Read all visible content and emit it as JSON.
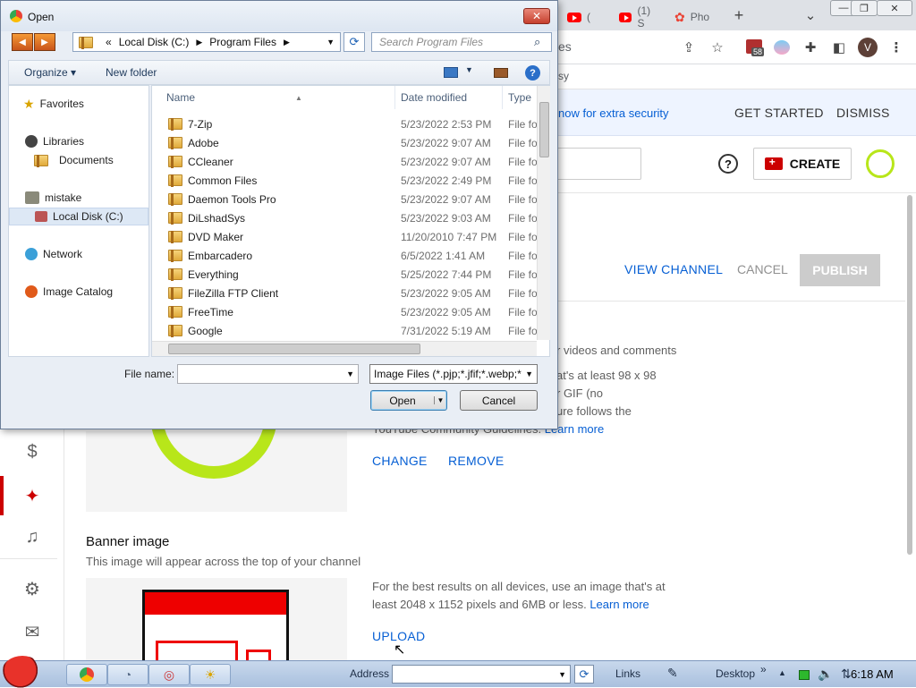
{
  "browser": {
    "tabs": [
      {
        "icon": "youtube-icon",
        "label": "("
      },
      {
        "icon": "youtube-icon",
        "label": "(1) S"
      },
      {
        "icon": "photos-icon",
        "label": "Pho"
      }
    ],
    "new_tab": "+",
    "window_controls": {
      "dropdown": "⌄",
      "minimize": "—",
      "restore": "❐",
      "close": "✕"
    },
    "omnibox_suffix": "es",
    "extension_badge": "58",
    "avatar_letter": "V",
    "bookmark_text": "sy"
  },
  "studio": {
    "banner": {
      "text": "now for extra security",
      "get_started": "GET STARTED",
      "dismiss": "DISMISS"
    },
    "header": {
      "create_label": "CREATE"
    },
    "actions": {
      "view_channel": "VIEW CHANNEL",
      "cancel": "CANCEL",
      "publish": "PUBLISH"
    },
    "picture": {
      "line1": "r videos and comments",
      "desc1": "at's at least 98 x 98",
      "desc2": "r GIF (no",
      "desc3": "ure follows the",
      "desc4": "YouTube Community Guidelines.",
      "learn_more": "Learn more",
      "change": "CHANGE",
      "remove": "REMOVE"
    },
    "banner_image": {
      "title": "Banner image",
      "subtitle": "This image will appear across the top of your channel",
      "desc_line1": "For the best results on all devices, use an image that's at",
      "desc_line2": "least 2048 x 1152 pixels and 6MB or less.",
      "learn_more": "Learn more",
      "upload": "UPLOAD"
    },
    "sidebar_icons": [
      "dollar-icon",
      "magic-wand-icon",
      "audio-library-icon",
      "settings-icon",
      "feedback-icon"
    ]
  },
  "dialog": {
    "title": "Open",
    "breadcrumb": {
      "prefix": "«",
      "parts": [
        "Local Disk (C:)",
        "Program Files"
      ]
    },
    "search_placeholder": "Search Program Files",
    "organize": "Organize ▾",
    "new_folder": "New folder",
    "nav": {
      "favorites": "Favorites",
      "libraries": "Libraries",
      "documents": "Documents",
      "mistake": "mistake",
      "local_disk": "Local Disk (C:)",
      "network": "Network",
      "image_catalog": "Image Catalog"
    },
    "columns": {
      "name": "Name",
      "date": "Date modified",
      "type": "Type"
    },
    "files": [
      {
        "name": "7-Zip",
        "date": "5/23/2022 2:53 PM",
        "type": "File fol"
      },
      {
        "name": "Adobe",
        "date": "5/23/2022 9:07 AM",
        "type": "File fol"
      },
      {
        "name": "CCleaner",
        "date": "5/23/2022 9:07 AM",
        "type": "File fol"
      },
      {
        "name": "Common Files",
        "date": "5/23/2022 2:49 PM",
        "type": "File fol"
      },
      {
        "name": "Daemon Tools Pro",
        "date": "5/23/2022 9:07 AM",
        "type": "File fol"
      },
      {
        "name": "DiLshadSys",
        "date": "5/23/2022 9:03 AM",
        "type": "File fol"
      },
      {
        "name": "DVD Maker",
        "date": "11/20/2010 7:47 PM",
        "type": "File fol"
      },
      {
        "name": "Embarcadero",
        "date": "6/5/2022 1:41 AM",
        "type": "File fol"
      },
      {
        "name": "Everything",
        "date": "5/25/2022 7:44 PM",
        "type": "File fol"
      },
      {
        "name": "FileZilla FTP Client",
        "date": "5/23/2022 9:05 AM",
        "type": "File fol"
      },
      {
        "name": "FreeTime",
        "date": "5/23/2022 9:05 AM",
        "type": "File fol"
      },
      {
        "name": "Google",
        "date": "7/31/2022 5:19 AM",
        "type": "File fol"
      }
    ],
    "file_name_label": "File name:",
    "file_name_value": "",
    "filter": "Image Files (*.pjp;*.jfif;*.webp;*",
    "open": "Open",
    "cancel": "Cancel"
  },
  "taskbar": {
    "address_label": "Address",
    "links": "Links",
    "desktop": "Desktop",
    "chevron": "»",
    "clock": "6:18 AM"
  },
  "colors": {
    "youtube_red": "#ff0000",
    "link_blue": "#065fd4",
    "accent_green": "#b8e61a"
  }
}
